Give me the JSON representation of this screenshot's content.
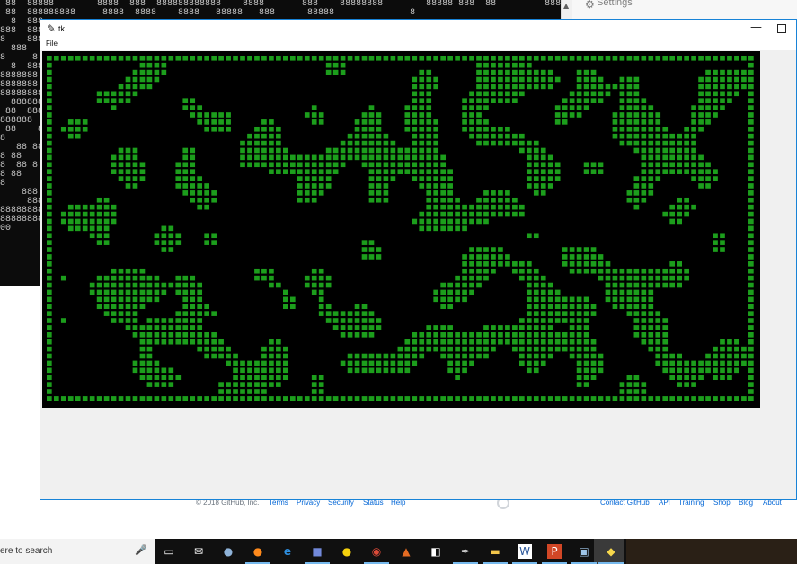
{
  "console": {
    "lines": [
      " 88  88888        8888  888  888888888888    8888       888    88888888        88888 888  88         8888888888888  888",
      " 88  888888888     8888  8888    8888   88888   888      88888              8",
      "  8  888",
      "888  888",
      "8    888",
      "  888",
      "8     8",
      "  8  888",
      "8888888",
      "8888888",
      "88888888",
      "  888888",
      " 88  888",
      "888888",
      " 88    8",
      "8",
      "   88 88",
      "8 88",
      "8  88 8",
      "8 88",
      "8",
      "    888",
      "",
      "     888",
      "",
      "",
      "88888888",
      "88888888",
      "00"
    ]
  },
  "settings_panel": {
    "icon": "gear-icon",
    "label": "Settings"
  },
  "footer": {
    "copyright": "© 2018 GitHub, Inc.",
    "links_left": [
      "Terms",
      "Privacy",
      "Security",
      "Status",
      "Help"
    ],
    "links_right": [
      "Contact GitHub",
      "API",
      "Training",
      "Shop",
      "Blog",
      "About"
    ]
  },
  "window": {
    "title": "tk",
    "icon": "feather-icon",
    "menu": [
      "File"
    ],
    "controls": [
      "minimize",
      "maximize"
    ]
  },
  "canvas": {
    "background": "#000000",
    "cell_color": "#1c9e1c",
    "cols": 99,
    "rows": 49
  },
  "taskbar": {
    "search_text": "ere to search",
    "icons": [
      "task-view-icon",
      "mail-icon",
      "steam-icon",
      "firefox-icon",
      "edge-icon",
      "discord-icon",
      "emoji-icon",
      "chrome-icon",
      "matlab-icon",
      "notes-icon",
      "inkscape-icon",
      "explorer-icon",
      "word-icon",
      "powerpoint-icon",
      "photos-icon",
      "python-icon"
    ]
  }
}
